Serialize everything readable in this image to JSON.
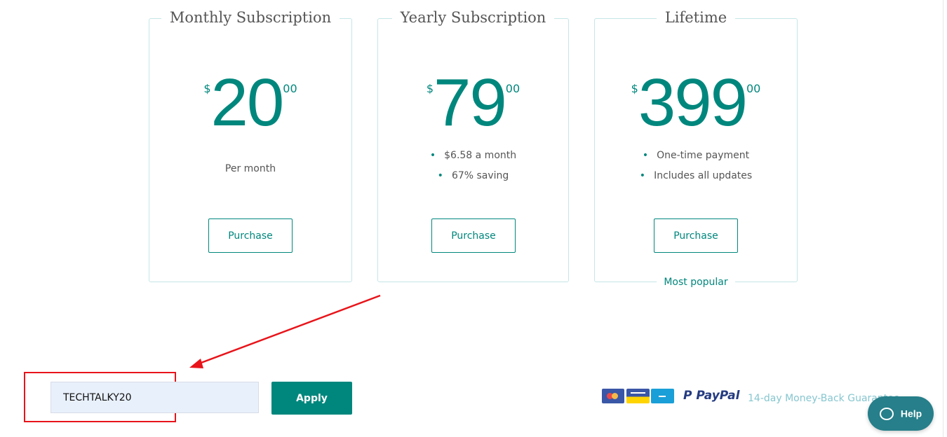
{
  "plans": [
    {
      "title": "Monthly Subscription",
      "currency": "$",
      "amount": "20",
      "cents": "00",
      "subtitle": "Per month",
      "button": "Purchase"
    },
    {
      "title": "Yearly Subscription",
      "currency": "$",
      "amount": "79",
      "cents": "00",
      "bullets": [
        "$6.58 a month",
        "67% saving"
      ],
      "button": "Purchase"
    },
    {
      "title": "Lifetime",
      "currency": "$",
      "amount": "399",
      "cents": "00",
      "bullets": [
        "One-time payment",
        "Includes all updates"
      ],
      "button": "Purchase",
      "badge": "Most popular"
    }
  ],
  "coupon": {
    "value": "TECHTALKY20",
    "apply": "Apply"
  },
  "footer": {
    "paypal": "PayPal",
    "guarantee": "14-day Money-Back Guarantee",
    "help": "Help"
  },
  "colors": {
    "accent": "#00877d",
    "annotation": "#e8141a",
    "help": "#267f8a"
  }
}
